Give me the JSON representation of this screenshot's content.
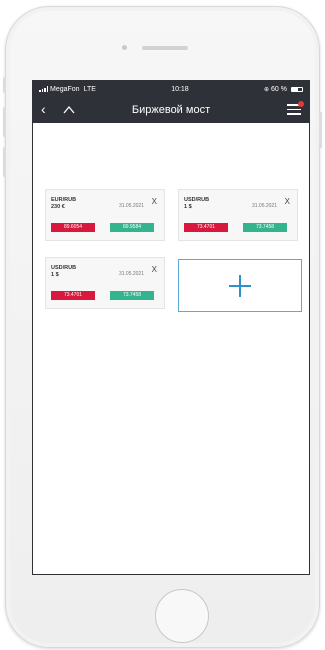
{
  "status": {
    "carrier": "MegaFon",
    "network": "LTE",
    "time": "10:18",
    "battery": "60 %"
  },
  "nav": {
    "back_icon": "chevron-left-icon",
    "home_icon": "home-icon",
    "title": "Биржевой мост",
    "menu_icon": "menu-icon"
  },
  "cards": [
    {
      "pair": "EUR/RUB",
      "amount": "230 €",
      "date": "31.05.2021",
      "close": "X",
      "sell": "89.6054",
      "buy": "89.9584"
    },
    {
      "pair": "USD/RUB",
      "amount": "1 $",
      "date": "31.05.2021",
      "close": "X",
      "sell": "73.4701",
      "buy": "73.7458"
    },
    {
      "pair": "USD/RUB",
      "amount": "1 $",
      "date": "31.05.2021",
      "close": "X",
      "sell": "73.4701",
      "buy": "73.7458"
    }
  ],
  "add_card": {
    "icon": "plus-icon"
  },
  "colors": {
    "bar": "#2f3138",
    "sell": "#d8183c",
    "buy": "#35b38f",
    "accent": "#2f91cc"
  }
}
